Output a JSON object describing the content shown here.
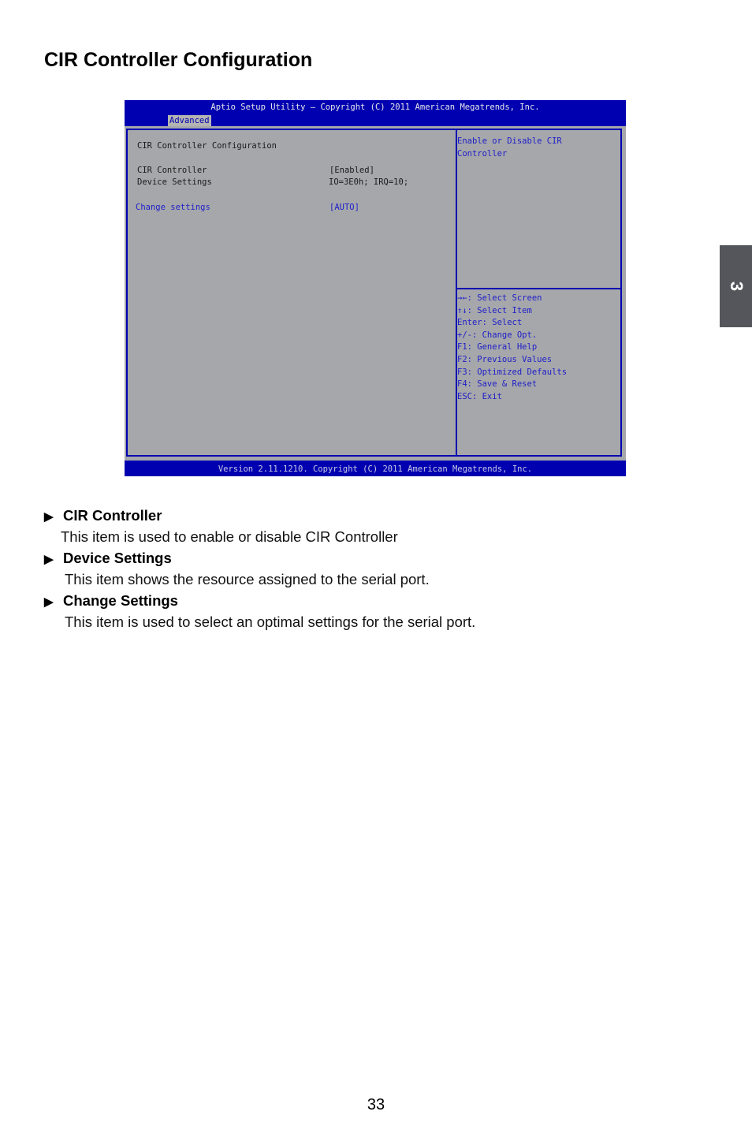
{
  "page": {
    "title": "CIR Controller Configuration",
    "page_number": "33",
    "chapter_tab": "3"
  },
  "bios": {
    "header": "Aptio Setup Utility – Copyright (C) 2011 American Megatrends, Inc.",
    "active_tab": "Advanced",
    "section_title": "CIR Controller Configuration",
    "items": [
      {
        "label": "CIR Controller",
        "value": "[Enabled]",
        "selected": false
      },
      {
        "label": "Device Settings",
        "value": "IO=3E0h; IRQ=10;",
        "selected": false
      },
      {
        "label": "Change settings",
        "value": "[AUTO]",
        "selected": true
      }
    ],
    "help_text": "Enable or Disable CIR\nController",
    "key_help": [
      "→←: Select Screen",
      "↑↓: Select Item",
      "Enter: Select",
      "+/-: Change Opt.",
      "F1: General Help",
      "F2: Previous Values",
      "F3: Optimized Defaults",
      "F4: Save & Reset",
      "ESC: Exit"
    ],
    "footer": "Version 2.11.1210. Copyright (C) 2011 American Megatrends, Inc.",
    "colors": {
      "frame_blue": "#0000b0",
      "panel_gray": "#a6a7ab",
      "highlight_blue": "#1e1ec8"
    }
  },
  "descriptions": [
    {
      "bullet_icon": "right-triangle",
      "heading": "CIR Controller",
      "text": "This item is used to enable or disable CIR Controller"
    },
    {
      "bullet_icon": "right-triangle",
      "heading": "Device Settings",
      "text": "This item shows the resource assigned to the serial port."
    },
    {
      "bullet_icon": "right-triangle",
      "heading": "Change Settings",
      "text": "This item is used to select an optimal settings for the serial port."
    }
  ]
}
